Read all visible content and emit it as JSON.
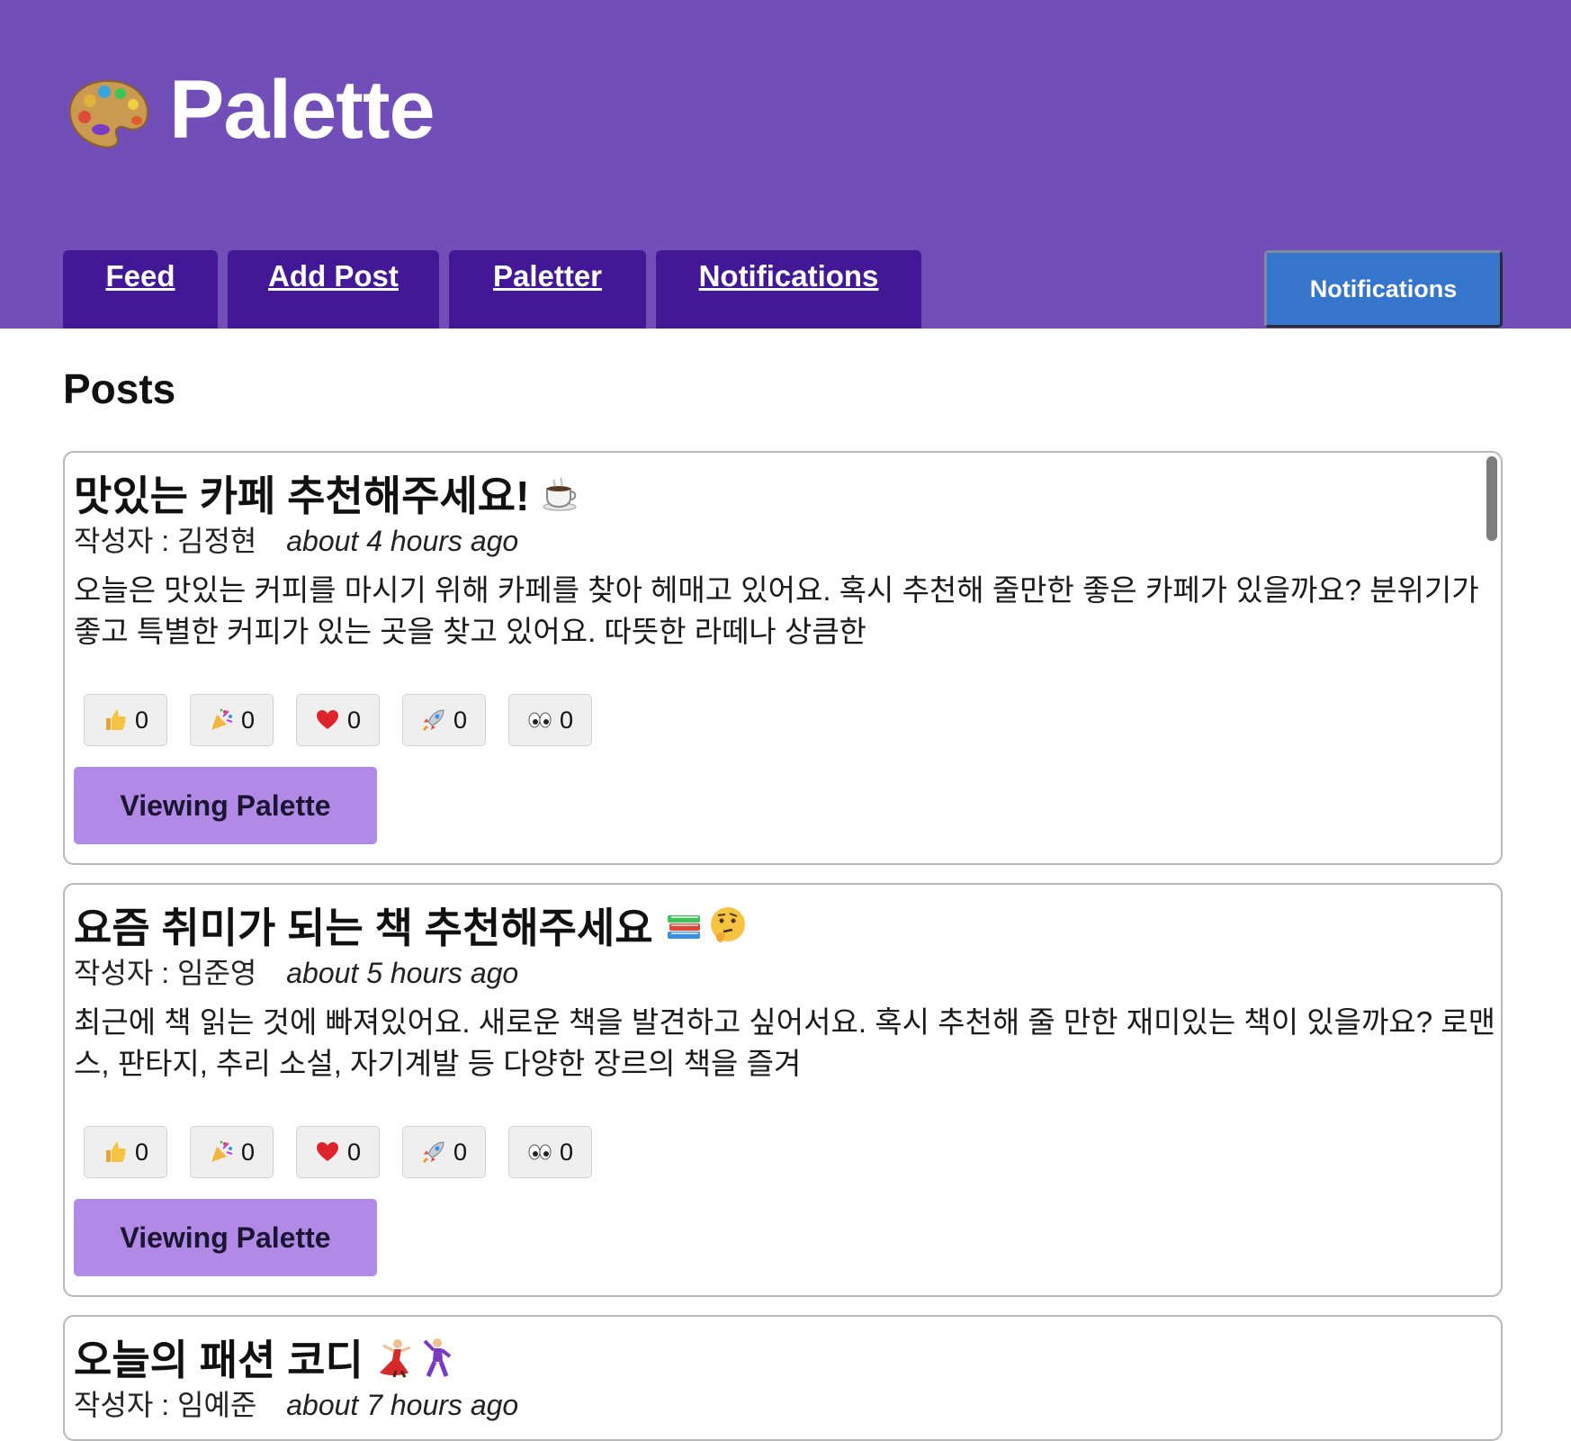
{
  "app": {
    "title": "Palette",
    "logo_icon": "palette-icon"
  },
  "nav": {
    "tabs": [
      {
        "label": "Feed"
      },
      {
        "label": "Add Post"
      },
      {
        "label": "Paletter"
      },
      {
        "label": "Notifications"
      }
    ],
    "notifications_button": "Notifications"
  },
  "main": {
    "section_title": "Posts",
    "posts": [
      {
        "title": "맛있는 카페 추천해주세요!",
        "title_emojis": [
          "coffee-icon"
        ],
        "author_prefix": "작성자 : ",
        "author": "김정현",
        "time": "about 4 hours ago",
        "body": "오늘은 맛있는 커피를 마시기 위해 카페를 찾아 헤매고 있어요. 혹시 추천해 줄만한 좋은 카페가 있을까요? 분위기가 좋고 특별한 커피가 있는 곳을 찾고 있어요. 따뜻한 라떼나 상큼한",
        "reactions": [
          {
            "icon": "thumbs-up-icon",
            "count": "0"
          },
          {
            "icon": "party-popper-icon",
            "count": "0"
          },
          {
            "icon": "heart-icon",
            "count": "0"
          },
          {
            "icon": "rocket-icon",
            "count": "0"
          },
          {
            "icon": "eyes-icon",
            "count": "0"
          }
        ],
        "view_button": "Viewing Palette"
      },
      {
        "title": "요즘 취미가 되는 책 추천해주세요",
        "title_emojis": [
          "books-icon",
          "thinking-face-icon"
        ],
        "author_prefix": "작성자 : ",
        "author": "임준영",
        "time": "about 5 hours ago",
        "body": "최근에 책 읽는 것에 빠져있어요. 새로운 책을 발견하고 싶어서요. 혹시 추천해 줄 만한 재미있는 책이 있을까요? 로맨스, 판타지, 추리 소설, 자기계발 등 다양한 장르의 책을 즐겨",
        "reactions": [
          {
            "icon": "thumbs-up-icon",
            "count": "0"
          },
          {
            "icon": "party-popper-icon",
            "count": "0"
          },
          {
            "icon": "heart-icon",
            "count": "0"
          },
          {
            "icon": "rocket-icon",
            "count": "0"
          },
          {
            "icon": "eyes-icon",
            "count": "0"
          }
        ],
        "view_button": "Viewing Palette"
      },
      {
        "title": "오늘의 패션 코디",
        "title_emojis": [
          "dancer-icon",
          "man-dancing-icon"
        ],
        "author_prefix": "작성자 : ",
        "author": "임예준",
        "time": "about 7 hours ago"
      }
    ]
  },
  "colors": {
    "header_bg": "#714eb8",
    "tab_bg": "#431896",
    "notif_button_bg": "#3675cc",
    "view_button_bg": "#b08ae6"
  }
}
